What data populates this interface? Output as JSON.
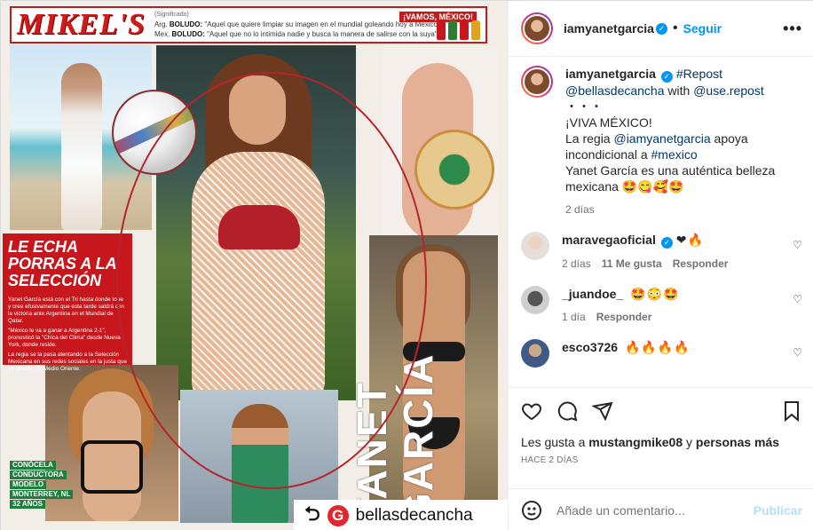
{
  "magazine": {
    "brand": "MIKEL'S",
    "glossary_title": "(Significado)",
    "gloss_rows": [
      {
        "country": "Arg.",
        "word": "BOLUDO:",
        "def": "\"Aquel que quiere limpiar su imagen en el mundial goleando hoy a México\""
      },
      {
        "country": "Mex.",
        "word": "BOLUDO:",
        "def": "\"Aquel que no lo intimida nadie y busca la manera de salirse con la suya\""
      }
    ],
    "vamos": "¡VAMOS, MÉXICO!",
    "panel_title": "LE ECHA PORRAS A LA SELECCIÓN",
    "panel_paragraphs": [
      "Yanet García está con el Tri hasta donde tope y cree efusivamente que esta tarde saldrá con la victoria ante Argentina en el Mundial de Qatar.",
      "\"México le va a ganar a Argentina 2-1\", pronosticó la \"Chica del Clima\" desde Nueva York, donde reside.",
      "La regia se la pasa alentando a la Selección Mexicana en sus redes sociales en la justa que se disputa en Medio Oriente."
    ],
    "caption_lines": [
      "CONÓCELA",
      "CONDUCTORA",
      "MODELO",
      "MONTERREY, NL",
      "32 AÑOS"
    ],
    "vertical_name": "YANET GARCÍA"
  },
  "repost_bar": {
    "icon": "repost-icon",
    "g_letter": "G",
    "name": "bellasdecancha"
  },
  "header": {
    "username": "iamyanetgarcia",
    "dot": "•",
    "follow": "Seguir",
    "more": "•••"
  },
  "caption": {
    "username": "iamyanetgarcia",
    "repost_tag": "#Repost",
    "source": "@bellasdecancha",
    "with": "with",
    "tool": "@use.repost",
    "dots": "・・・",
    "line1": "¡VIVA MÉXICO!",
    "line2_pre": "La regia",
    "mention": "@iamyanetgarcia",
    "line2_post": "apoya incondicional a",
    "hashtag": "#mexico",
    "line3": "Yanet García es una auténtica belleza mexicana 🤩😋🥰🤩",
    "time": "2 días"
  },
  "comments": [
    {
      "user": "maravegaoficial",
      "verified": true,
      "text": "❤🔥",
      "time": "2 días",
      "likes": "11 Me gusta",
      "reply": "Responder"
    },
    {
      "user": "_juandoe_",
      "verified": false,
      "text": "🤩😳🤩",
      "time": "1 día",
      "likes": "",
      "reply": "Responder"
    },
    {
      "user": "esco3726",
      "verified": false,
      "text": "🔥🔥🔥🔥",
      "time": "",
      "likes": "",
      "reply": ""
    }
  ],
  "likes": {
    "prefix": "Les gusta a",
    "user": "mustangmike08",
    "mid": "y",
    "others": "personas más"
  },
  "post_time": "HACE 2 DÍAS",
  "add_comment": {
    "placeholder": "Añade un comentario...",
    "publish": "Publicar",
    "icon": "emoji-icon"
  },
  "colors": {
    "accent": "#0095f6",
    "magazine_red": "#c8161d",
    "publish_disabled": "#b2dffc"
  }
}
